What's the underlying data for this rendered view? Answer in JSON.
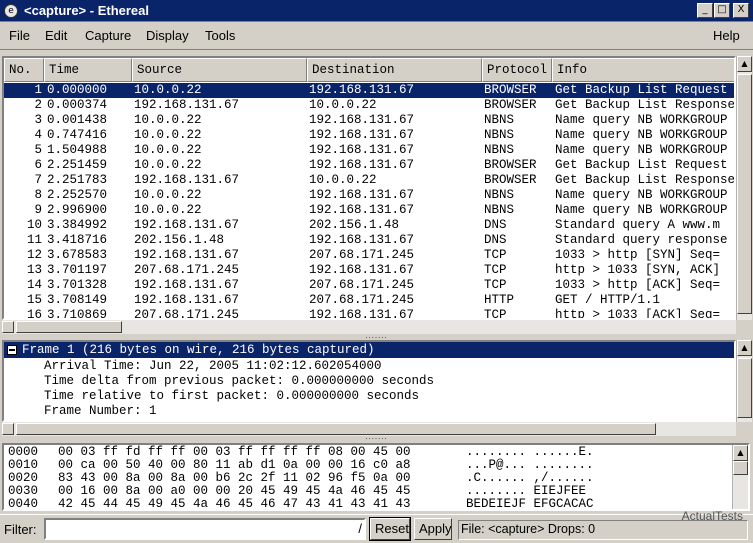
{
  "window": {
    "title": "<capture> - Ethereal",
    "minimize": "_",
    "maximize": "□",
    "close": "X"
  },
  "menu": {
    "items": [
      "File",
      "Edit",
      "Capture",
      "Display",
      "Tools"
    ],
    "help": "Help"
  },
  "packet_list": {
    "columns": [
      "No.",
      "Time",
      "Source",
      "Destination",
      "Protocol",
      "Info"
    ],
    "sort_indicator": "⌄",
    "rows": [
      {
        "no": "1",
        "time": "0.000000",
        "src": "10.0.0.22",
        "dst": "192.168.131.67",
        "proto": "BROWSER",
        "info": "Get Backup List Request"
      },
      {
        "no": "2",
        "time": "0.000374",
        "src": "192.168.131.67",
        "dst": "10.0.0.22",
        "proto": "BROWSER",
        "info": "Get Backup List Response"
      },
      {
        "no": "3",
        "time": "0.001438",
        "src": "10.0.0.22",
        "dst": "192.168.131.67",
        "proto": "NBNS",
        "info": "Name query NB WORKGROUP"
      },
      {
        "no": "4",
        "time": "0.747416",
        "src": "10.0.0.22",
        "dst": "192.168.131.67",
        "proto": "NBNS",
        "info": "Name query NB WORKGROUP"
      },
      {
        "no": "5",
        "time": "1.504988",
        "src": "10.0.0.22",
        "dst": "192.168.131.67",
        "proto": "NBNS",
        "info": "Name query NB WORKGROUP"
      },
      {
        "no": "6",
        "time": "2.251459",
        "src": "10.0.0.22",
        "dst": "192.168.131.67",
        "proto": "BROWSER",
        "info": "Get Backup List Request"
      },
      {
        "no": "7",
        "time": "2.251783",
        "src": "192.168.131.67",
        "dst": "10.0.0.22",
        "proto": "BROWSER",
        "info": "Get Backup List Response"
      },
      {
        "no": "8",
        "time": "2.252570",
        "src": "10.0.0.22",
        "dst": "192.168.131.67",
        "proto": "NBNS",
        "info": "Name query NB WORKGROUP"
      },
      {
        "no": "9",
        "time": "2.996900",
        "src": "10.0.0.22",
        "dst": "192.168.131.67",
        "proto": "NBNS",
        "info": "Name query NB WORKGROUP"
      },
      {
        "no": "10",
        "time": "3.384992",
        "src": "192.168.131.67",
        "dst": "202.156.1.48",
        "proto": "DNS",
        "info": "Standard query A www.m"
      },
      {
        "no": "11",
        "time": "3.418716",
        "src": "202.156.1.48",
        "dst": "192.168.131.67",
        "proto": "DNS",
        "info": "Standard query response"
      },
      {
        "no": "12",
        "time": "3.678583",
        "src": "192.168.131.67",
        "dst": "207.68.171.245",
        "proto": "TCP",
        "info": "1033 > http [SYN] Seq="
      },
      {
        "no": "13",
        "time": "3.701197",
        "src": "207.68.171.245",
        "dst": "192.168.131.67",
        "proto": "TCP",
        "info": "http > 1033 [SYN, ACK]"
      },
      {
        "no": "14",
        "time": "3.701328",
        "src": "192.168.131.67",
        "dst": "207.68.171.245",
        "proto": "TCP",
        "info": "1033 > http [ACK] Seq="
      },
      {
        "no": "15",
        "time": "3.708149",
        "src": "192.168.131.67",
        "dst": "207.68.171.245",
        "proto": "HTTP",
        "info": "GET / HTTP/1.1"
      },
      {
        "no": "16",
        "time": "3.710869",
        "src": "207.68.171.245",
        "dst": "192.168.131.67",
        "proto": "TCP",
        "info": "http > 1033 [ACK] Seq="
      }
    ]
  },
  "detail": {
    "header": "Frame 1 (216 bytes on wire, 216 bytes captured)",
    "lines": [
      "Arrival Time: Jun 22, 2005 11:02:12.602054000",
      "Time delta from previous packet: 0.000000000 seconds",
      "Time relative to first packet: 0.000000000 seconds",
      "Frame Number: 1"
    ]
  },
  "hex": {
    "rows": [
      {
        "offset": "0000",
        "bytes": "00 03 ff fd ff ff 00 03  ff ff ff ff 08 00 45 00",
        "ascii": "........ ......E."
      },
      {
        "offset": "0010",
        "bytes": "00 ca 00 50 40 00 80 11  ab d1 0a 00 00 16 c0 a8",
        "ascii": "...P@... ........"
      },
      {
        "offset": "0020",
        "bytes": "83 43 00 8a 00 8a 00 b6  2c 2f 11 02 96 f5 0a 00",
        "ascii": ".C...... ,/......"
      },
      {
        "offset": "0030",
        "bytes": "00 16 00 8a 00 a0 00 00  20 45 49 45 4a 46 45 45",
        "ascii": "........  EIEJFEE"
      },
      {
        "offset": "0040",
        "bytes": "42 45 44 45 49 45 4a 46  45 46 47 43 41 43 41 43",
        "ascii": "BEDEIEJF EFGCACAC"
      }
    ]
  },
  "statusbar": {
    "filter_label": "Filter:",
    "filter_value": "",
    "filter_dropdown": "/",
    "reset_label": "Reset",
    "apply_label": "Apply",
    "status_text": "File: <capture>  Drops: 0",
    "watermark": "ActualTests"
  }
}
